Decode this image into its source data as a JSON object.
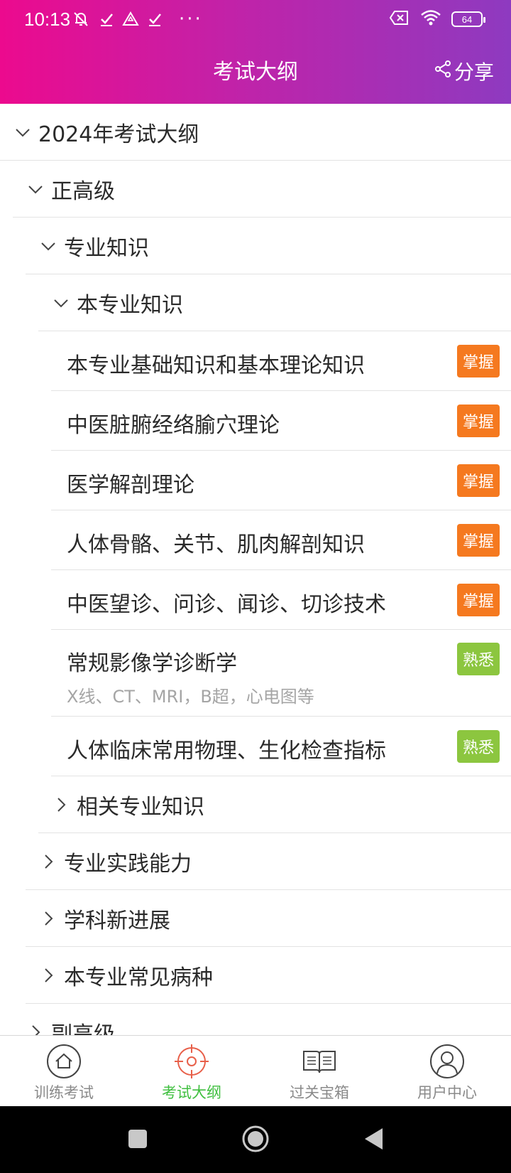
{
  "status_bar": {
    "time": "10:13",
    "extra_icons": "···",
    "battery": "64"
  },
  "header": {
    "title": "考试大纲",
    "share_label": "分享"
  },
  "tree": {
    "root": "2024年考试大纲",
    "level1": "正高级",
    "level2": "专业知识",
    "level3": "本专业知识",
    "items": [
      {
        "label": "本专业基础知识和基本理论知识",
        "badge": "掌握"
      },
      {
        "label": "中医脏腑经络腧穴理论",
        "badge": "掌握"
      },
      {
        "label": "医学解剖理论",
        "badge": "掌握"
      },
      {
        "label": "人体骨骼、关节、肌肉解剖知识",
        "badge": "掌握"
      },
      {
        "label": "中医望诊、问诊、闻诊、切诊技术",
        "badge": "掌握"
      },
      {
        "label": "常规影像学诊断学",
        "sub": "X线、CT、MRI，B超，心电图等",
        "badge": "熟悉"
      },
      {
        "label": "人体临床常用物理、生化检查指标",
        "badge": "熟悉"
      }
    ],
    "related": "相关专业知识",
    "practice": "专业实践能力",
    "progress": "学科新进展",
    "diseases": "本专业常见病种",
    "deputy": "副高级"
  },
  "badge_colors": {
    "master": "#f5791f",
    "familiar": "#8cc63f"
  },
  "tabs": [
    {
      "label": "训练考试",
      "icon": "home-icon"
    },
    {
      "label": "考试大纲",
      "icon": "target-icon",
      "active": true
    },
    {
      "label": "过关宝箱",
      "icon": "book-icon"
    },
    {
      "label": "用户中心",
      "icon": "user-icon"
    }
  ],
  "colors": {
    "header_gradient_start": "#ec0a8e",
    "header_gradient_end": "#8e3ac0",
    "active_tab": "#3fbf3f",
    "active_icon": "#e8604a"
  }
}
